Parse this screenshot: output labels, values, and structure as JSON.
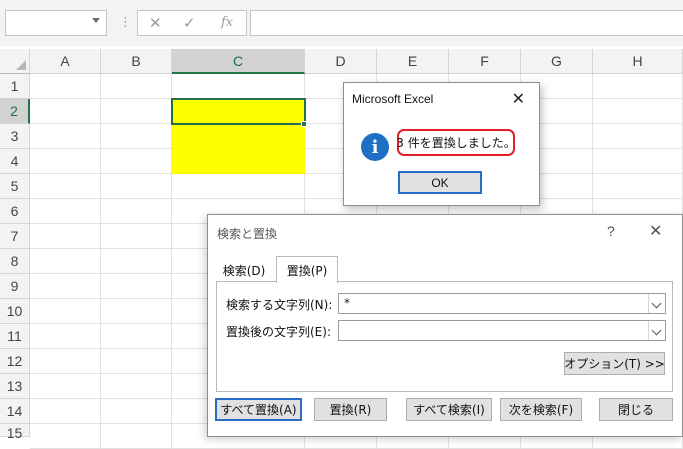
{
  "formula_bar": {
    "name_box_value": "",
    "separator": "⋮",
    "cancel_icon": "✕",
    "enter_icon": "✓",
    "function_icon": "fx",
    "formula_value": ""
  },
  "sheet": {
    "columns": [
      "A",
      "B",
      "C",
      "D",
      "E",
      "F",
      "G",
      "H"
    ],
    "rows": [
      "1",
      "2",
      "3",
      "4",
      "5",
      "6",
      "7",
      "8",
      "9",
      "10",
      "11",
      "12",
      "13",
      "14",
      "15"
    ],
    "selected_column": "C",
    "selected_row": "2",
    "highlight_color": "#ffff00",
    "accent_color": "#217346"
  },
  "message_box": {
    "title": "Microsoft Excel",
    "message": "3 件を置換しました。",
    "ok_label": "OK",
    "icon": "information-icon",
    "icon_glyph": "i",
    "close_glyph": "✕"
  },
  "find_replace": {
    "title": "検索と置換",
    "help_glyph": "?",
    "close_glyph": "✕",
    "tabs": [
      {
        "label": "検索(D)"
      },
      {
        "label": "置換(P)"
      }
    ],
    "find_label": "検索する文字列(N):",
    "find_value": "*",
    "replace_label": "置換後の文字列(E):",
    "replace_value": "",
    "options_label": "オプション(T) >>",
    "buttons": {
      "replace_all": "すべて置換(A)",
      "replace": "置換(R)",
      "find_all": "すべて検索(I)",
      "find_next": "次を検索(F)",
      "close": "閉じる"
    }
  }
}
